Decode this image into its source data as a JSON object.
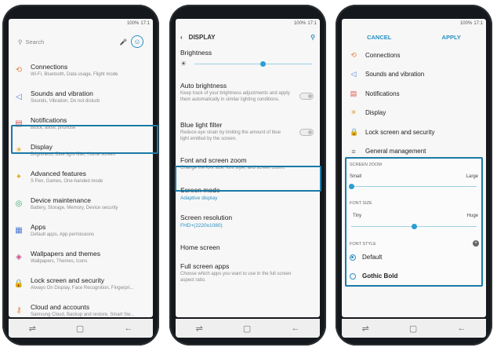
{
  "status_time": "17:1",
  "status_battery": "100%",
  "phone1": {
    "search_placeholder": "Search",
    "items": [
      {
        "icon": "connections-icon",
        "glyph": "⟲",
        "color": "#e6864a",
        "title": "Connections",
        "subtitle": "Wi-Fi, Bluetooth, Data usage, Flight mode"
      },
      {
        "icon": "sound-icon",
        "glyph": "◁",
        "color": "#4a7ad8",
        "title": "Sounds and vibration",
        "subtitle": "Sounds, Vibration, Do not disturb"
      },
      {
        "icon": "notifications-icon",
        "glyph": "▤",
        "color": "#d9534f",
        "title": "Notifications",
        "subtitle": "Block, allow, prioritise"
      },
      {
        "icon": "display-icon",
        "glyph": "☀",
        "color": "#e6a72a",
        "title": "Display",
        "subtitle": "Brightness, Blue light filter, Home screen"
      },
      {
        "icon": "advanced-features-icon",
        "glyph": "✦",
        "color": "#e6a72a",
        "title": "Advanced features",
        "subtitle": "S Pen, Games, One-handed mode"
      },
      {
        "icon": "device-maintenance-icon",
        "glyph": "◎",
        "color": "#3aa56b",
        "title": "Device maintenance",
        "subtitle": "Battery, Storage, Memory, Device security"
      },
      {
        "icon": "apps-icon",
        "glyph": "▦",
        "color": "#4a7ad8",
        "title": "Apps",
        "subtitle": "Default apps, App permissions"
      },
      {
        "icon": "wallpapers-icon",
        "glyph": "◈",
        "color": "#c7538a",
        "title": "Wallpapers and themes",
        "subtitle": "Wallpapers, Themes, Icons"
      },
      {
        "icon": "lock-icon",
        "glyph": "🔒",
        "color": "#4a7ad8",
        "title": "Lock screen and security",
        "subtitle": "Always On Display, Face Recognition, Fingerpri..."
      },
      {
        "icon": "accounts-icon",
        "glyph": "⚷",
        "color": "#e6864a",
        "title": "Cloud and accounts",
        "subtitle": "Samsung Cloud, Backup and restore, Smart Sw..."
      }
    ]
  },
  "phone2": {
    "title": "DISPLAY",
    "brightness_label": "Brightness",
    "brightness_level": 0.58,
    "auto_brightness": {
      "title": "Auto brightness",
      "subtitle": "Keep track of your brightness adjustments and apply them automatically in similar lighting conditions."
    },
    "blue_light": {
      "title": "Blue light filter",
      "subtitle": "Reduce eye strain by limiting the amount of blue light emitted by the screen."
    },
    "font_zoom": {
      "title": "Font and screen zoom",
      "subtitle": "Change the font size, font style, and screen zoom."
    },
    "screen_mode": {
      "title": "Screen mode",
      "value": "Adaptive display"
    },
    "resolution": {
      "title": "Screen resolution",
      "value": "FHD+(2220x1080)"
    },
    "home_screen": {
      "title": "Home screen"
    },
    "full_screen": {
      "title": "Full screen apps",
      "subtitle": "Choose which apps you want to use in the full screen aspect ratio."
    }
  },
  "phone3": {
    "cancel": "CANCEL",
    "apply": "APPLY",
    "items": [
      {
        "icon": "connections-icon",
        "glyph": "⟲",
        "color": "#e6864a",
        "label": "Connections"
      },
      {
        "icon": "sound-icon",
        "glyph": "◁",
        "color": "#4a7ad8",
        "label": "Sounds and vibration"
      },
      {
        "icon": "notifications-icon",
        "glyph": "▤",
        "color": "#d9534f",
        "label": "Notifications"
      },
      {
        "icon": "display-icon",
        "glyph": "☀",
        "color": "#e6a72a",
        "label": "Display"
      },
      {
        "icon": "lock-icon",
        "glyph": "🔒",
        "color": "#4a7ad8",
        "label": "Lock screen and security"
      },
      {
        "icon": "general-management-icon",
        "glyph": "≡",
        "color": "#777777",
        "label": "General management"
      }
    ],
    "screen_zoom_label": "SCREEN ZOOM",
    "zoom_small": "Small",
    "zoom_large": "Large",
    "zoom_level": 0.0,
    "font_size_label": "FONT SIZE",
    "size_tiny": "Tiny",
    "size_huge": "Huge",
    "font_size_level": 0.5,
    "font_style_label": "FONT STYLE",
    "styles": [
      {
        "label": "Default",
        "selected": true
      },
      {
        "label": "Gothic Bold",
        "selected": false
      }
    ]
  }
}
